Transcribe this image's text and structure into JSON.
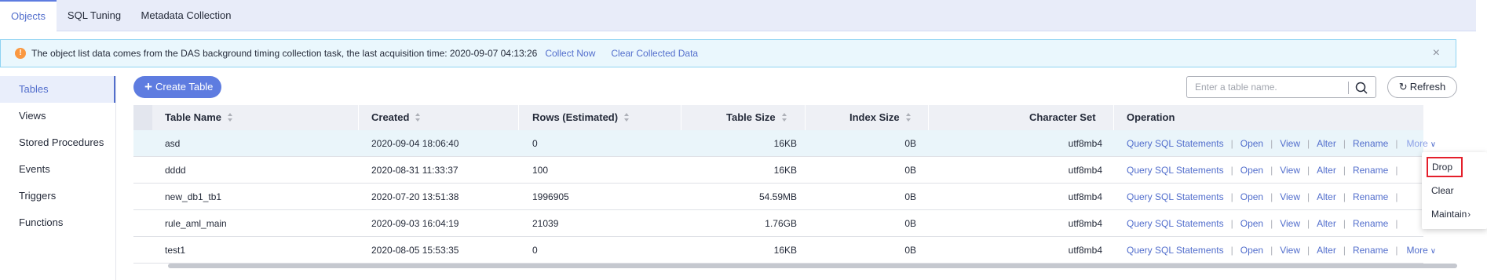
{
  "tabs": [
    {
      "label": "Objects",
      "active": true
    },
    {
      "label": "SQL Tuning",
      "active": false
    },
    {
      "label": "Metadata Collection",
      "active": false
    }
  ],
  "notice": {
    "icon": "info-icon",
    "text": "The object list data comes from the DAS background timing collection task, the last acquisition time: 2020-09-07 04:13:26",
    "collect_now": "Collect Now",
    "clear_collected": "Clear Collected Data",
    "close": "×"
  },
  "sidenav": {
    "items": [
      {
        "label": "Tables",
        "active": true
      },
      {
        "label": "Views",
        "active": false
      },
      {
        "label": "Stored Procedures",
        "active": false
      },
      {
        "label": "Events",
        "active": false
      },
      {
        "label": "Triggers",
        "active": false
      },
      {
        "label": "Functions",
        "active": false
      }
    ]
  },
  "toolbar": {
    "create_label": "Create Table",
    "search_placeholder": "Enter a table name.",
    "refresh_label": "Refresh"
  },
  "table": {
    "headers": {
      "name": "Table Name",
      "created": "Created",
      "rows": "Rows (Estimated)",
      "table_size": "Table Size",
      "index_size": "Index Size",
      "charset": "Character Set",
      "operation": "Operation"
    },
    "rows": [
      {
        "name": "asd",
        "created": "2020-09-04 18:06:40",
        "rows": "0",
        "table_size": "16KB",
        "index_size": "0B",
        "charset": "utf8mb4"
      },
      {
        "name": "dddd",
        "created": "2020-08-31 11:33:37",
        "rows": "100",
        "table_size": "16KB",
        "index_size": "0B",
        "charset": "utf8mb4"
      },
      {
        "name": "new_db1_tb1",
        "created": "2020-07-20 13:51:38",
        "rows": "1996905",
        "table_size": "54.59MB",
        "index_size": "0B",
        "charset": "utf8mb4"
      },
      {
        "name": "rule_aml_main",
        "created": "2020-09-03 16:04:19",
        "rows": "21039",
        "table_size": "1.76GB",
        "index_size": "0B",
        "charset": "utf8mb4"
      },
      {
        "name": "test1",
        "created": "2020-08-05 15:53:35",
        "rows": "0",
        "table_size": "16KB",
        "index_size": "0B",
        "charset": "utf8mb4"
      }
    ],
    "operations": {
      "query": "Query SQL Statements",
      "open": "Open",
      "view": "View",
      "alter": "Alter",
      "rename": "Rename",
      "more": "More",
      "separator": "|"
    }
  },
  "dropdown": {
    "items": [
      {
        "label": "Drop",
        "highlighted": true
      },
      {
        "label": "Clear",
        "highlighted": false
      },
      {
        "label": "Maintain",
        "highlighted": false,
        "submenu": true
      }
    ]
  },
  "colors": {
    "accent": "#526ecc",
    "primary_button": "#5e7ce0",
    "notice_bg": "#eaf7fd",
    "notice_border": "#8ed3f2",
    "warning_icon": "#fa9841",
    "highlight_border": "#e41f2b"
  }
}
